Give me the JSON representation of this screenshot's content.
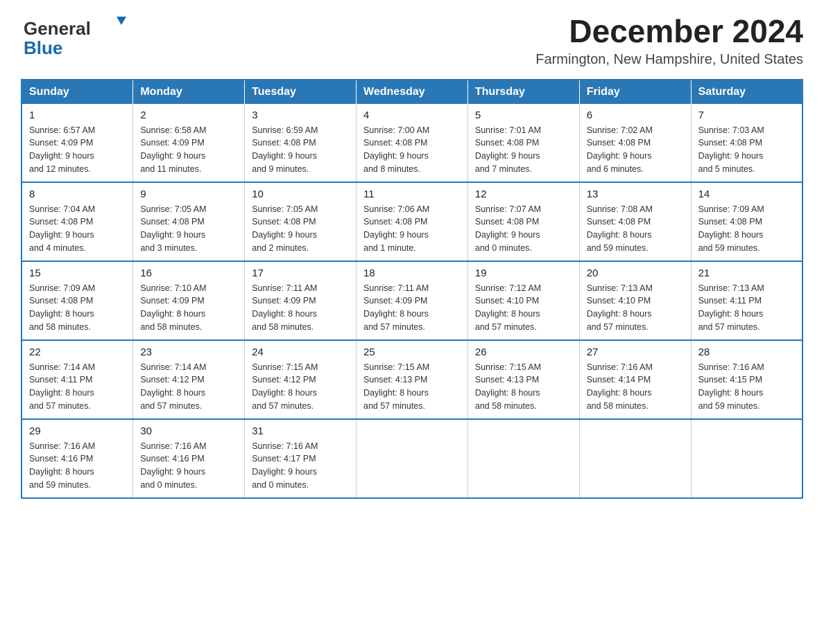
{
  "header": {
    "logo_line1": "General",
    "logo_line2": "Blue",
    "month_title": "December 2024",
    "subtitle": "Farmington, New Hampshire, United States"
  },
  "days_of_week": [
    "Sunday",
    "Monday",
    "Tuesday",
    "Wednesday",
    "Thursday",
    "Friday",
    "Saturday"
  ],
  "weeks": [
    [
      {
        "day": "1",
        "info": "Sunrise: 6:57 AM\nSunset: 4:09 PM\nDaylight: 9 hours\nand 12 minutes."
      },
      {
        "day": "2",
        "info": "Sunrise: 6:58 AM\nSunset: 4:09 PM\nDaylight: 9 hours\nand 11 minutes."
      },
      {
        "day": "3",
        "info": "Sunrise: 6:59 AM\nSunset: 4:08 PM\nDaylight: 9 hours\nand 9 minutes."
      },
      {
        "day": "4",
        "info": "Sunrise: 7:00 AM\nSunset: 4:08 PM\nDaylight: 9 hours\nand 8 minutes."
      },
      {
        "day": "5",
        "info": "Sunrise: 7:01 AM\nSunset: 4:08 PM\nDaylight: 9 hours\nand 7 minutes."
      },
      {
        "day": "6",
        "info": "Sunrise: 7:02 AM\nSunset: 4:08 PM\nDaylight: 9 hours\nand 6 minutes."
      },
      {
        "day": "7",
        "info": "Sunrise: 7:03 AM\nSunset: 4:08 PM\nDaylight: 9 hours\nand 5 minutes."
      }
    ],
    [
      {
        "day": "8",
        "info": "Sunrise: 7:04 AM\nSunset: 4:08 PM\nDaylight: 9 hours\nand 4 minutes."
      },
      {
        "day": "9",
        "info": "Sunrise: 7:05 AM\nSunset: 4:08 PM\nDaylight: 9 hours\nand 3 minutes."
      },
      {
        "day": "10",
        "info": "Sunrise: 7:05 AM\nSunset: 4:08 PM\nDaylight: 9 hours\nand 2 minutes."
      },
      {
        "day": "11",
        "info": "Sunrise: 7:06 AM\nSunset: 4:08 PM\nDaylight: 9 hours\nand 1 minute."
      },
      {
        "day": "12",
        "info": "Sunrise: 7:07 AM\nSunset: 4:08 PM\nDaylight: 9 hours\nand 0 minutes."
      },
      {
        "day": "13",
        "info": "Sunrise: 7:08 AM\nSunset: 4:08 PM\nDaylight: 8 hours\nand 59 minutes."
      },
      {
        "day": "14",
        "info": "Sunrise: 7:09 AM\nSunset: 4:08 PM\nDaylight: 8 hours\nand 59 minutes."
      }
    ],
    [
      {
        "day": "15",
        "info": "Sunrise: 7:09 AM\nSunset: 4:08 PM\nDaylight: 8 hours\nand 58 minutes."
      },
      {
        "day": "16",
        "info": "Sunrise: 7:10 AM\nSunset: 4:09 PM\nDaylight: 8 hours\nand 58 minutes."
      },
      {
        "day": "17",
        "info": "Sunrise: 7:11 AM\nSunset: 4:09 PM\nDaylight: 8 hours\nand 58 minutes."
      },
      {
        "day": "18",
        "info": "Sunrise: 7:11 AM\nSunset: 4:09 PM\nDaylight: 8 hours\nand 57 minutes."
      },
      {
        "day": "19",
        "info": "Sunrise: 7:12 AM\nSunset: 4:10 PM\nDaylight: 8 hours\nand 57 minutes."
      },
      {
        "day": "20",
        "info": "Sunrise: 7:13 AM\nSunset: 4:10 PM\nDaylight: 8 hours\nand 57 minutes."
      },
      {
        "day": "21",
        "info": "Sunrise: 7:13 AM\nSunset: 4:11 PM\nDaylight: 8 hours\nand 57 minutes."
      }
    ],
    [
      {
        "day": "22",
        "info": "Sunrise: 7:14 AM\nSunset: 4:11 PM\nDaylight: 8 hours\nand 57 minutes."
      },
      {
        "day": "23",
        "info": "Sunrise: 7:14 AM\nSunset: 4:12 PM\nDaylight: 8 hours\nand 57 minutes."
      },
      {
        "day": "24",
        "info": "Sunrise: 7:15 AM\nSunset: 4:12 PM\nDaylight: 8 hours\nand 57 minutes."
      },
      {
        "day": "25",
        "info": "Sunrise: 7:15 AM\nSunset: 4:13 PM\nDaylight: 8 hours\nand 57 minutes."
      },
      {
        "day": "26",
        "info": "Sunrise: 7:15 AM\nSunset: 4:13 PM\nDaylight: 8 hours\nand 58 minutes."
      },
      {
        "day": "27",
        "info": "Sunrise: 7:16 AM\nSunset: 4:14 PM\nDaylight: 8 hours\nand 58 minutes."
      },
      {
        "day": "28",
        "info": "Sunrise: 7:16 AM\nSunset: 4:15 PM\nDaylight: 8 hours\nand 59 minutes."
      }
    ],
    [
      {
        "day": "29",
        "info": "Sunrise: 7:16 AM\nSunset: 4:16 PM\nDaylight: 8 hours\nand 59 minutes."
      },
      {
        "day": "30",
        "info": "Sunrise: 7:16 AM\nSunset: 4:16 PM\nDaylight: 9 hours\nand 0 minutes."
      },
      {
        "day": "31",
        "info": "Sunrise: 7:16 AM\nSunset: 4:17 PM\nDaylight: 9 hours\nand 0 minutes."
      },
      {
        "day": "",
        "info": ""
      },
      {
        "day": "",
        "info": ""
      },
      {
        "day": "",
        "info": ""
      },
      {
        "day": "",
        "info": ""
      }
    ]
  ]
}
